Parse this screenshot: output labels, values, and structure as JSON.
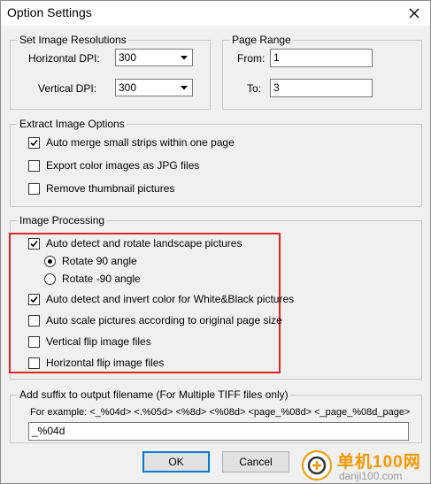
{
  "window": {
    "title": "Option Settings",
    "close_icon": "close-icon"
  },
  "resolutions": {
    "title": "Set Image Resolutions",
    "horizontal_label": "Horizontal DPI:",
    "horizontal_value": "300",
    "vertical_label": "Vertical DPI:",
    "vertical_value": "300"
  },
  "page_range": {
    "title": "Page Range",
    "from_label": "From:",
    "from_value": "1",
    "to_label": "To:",
    "to_value": "3"
  },
  "extract": {
    "title": "Extract Image Options",
    "options": [
      {
        "label": "Auto merge small strips within one page",
        "checked": true
      },
      {
        "label": "Export color images as JPG files",
        "checked": false
      },
      {
        "label": "Remove thumbnail pictures",
        "checked": false
      }
    ]
  },
  "processing": {
    "title": "Image Processing",
    "auto_rotate": {
      "label": "Auto detect and rotate landscape pictures",
      "checked": true
    },
    "rotate_90": {
      "label": "Rotate 90 angle",
      "selected": true
    },
    "rotate_neg90": {
      "label": "Rotate -90 angle",
      "selected": false
    },
    "invert": {
      "label": "Auto detect and invert color for White&Black pictures",
      "checked": true
    },
    "scale": {
      "label": "Auto scale pictures according to original page size",
      "checked": false
    },
    "vflip": {
      "label": "Vertical flip image files",
      "checked": false
    },
    "hflip": {
      "label": "Horizontal flip image files",
      "checked": false
    },
    "highlight_color": "#e0242a"
  },
  "suffix": {
    "title": "Add suffix to output filename (For Multiple TIFF files only)",
    "example": "For example: <_%04d> <.%05d> <%8d> <%08d> <page_%08d> <_page_%08d_page>",
    "value": "_%04d"
  },
  "buttons": {
    "ok": "OK",
    "cancel": "Cancel"
  },
  "watermark": {
    "name": "单机100网",
    "url": "danji100.com",
    "color": "#f39800"
  }
}
